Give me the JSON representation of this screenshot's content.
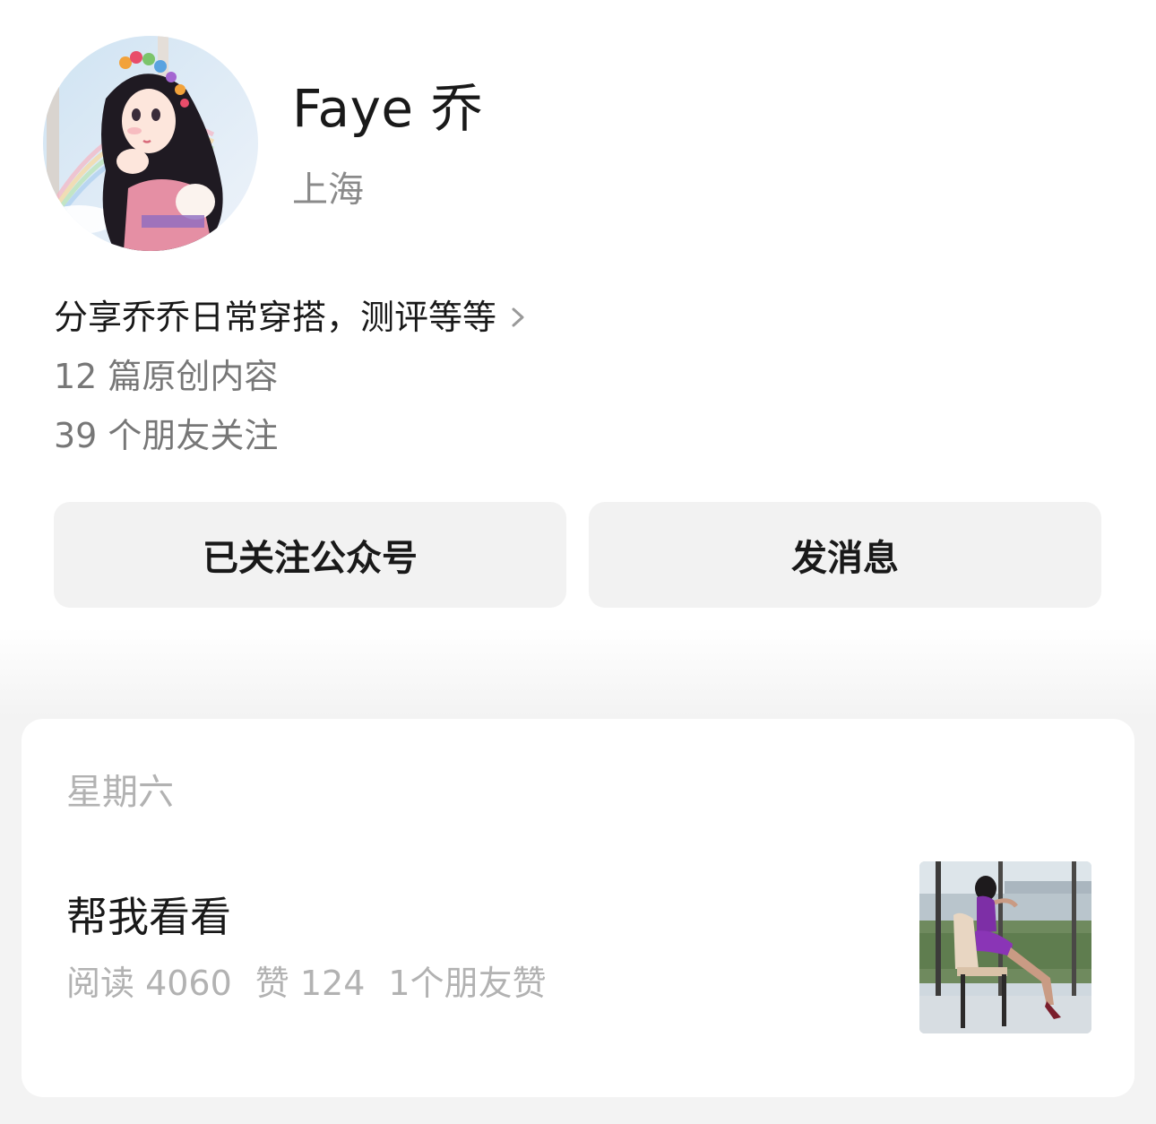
{
  "profile": {
    "name": "Faye 乔",
    "location": "上海",
    "bio": "分享乔乔日常穿搭，测评等等",
    "articles_count": "12 篇原创内容",
    "friends_following": "39 个朋友关注",
    "avatar_icon": "cartoon-princess-avatar"
  },
  "actions": {
    "follow_label": "已关注公众号",
    "message_label": "发消息"
  },
  "feed": {
    "day_label": "星期六",
    "articles": [
      {
        "title": "帮我看看",
        "reads": "阅读 4060",
        "likes": "赞 124",
        "friend_likes": "1个朋友赞",
        "thumbnail_icon": "woman-in-purple-dress-photo"
      }
    ]
  },
  "colors": {
    "button_bg": "#f2f2f2",
    "secondary_text": "#777777",
    "muted_text": "#b2b2b2",
    "page_bg": "#f3f3f3"
  }
}
